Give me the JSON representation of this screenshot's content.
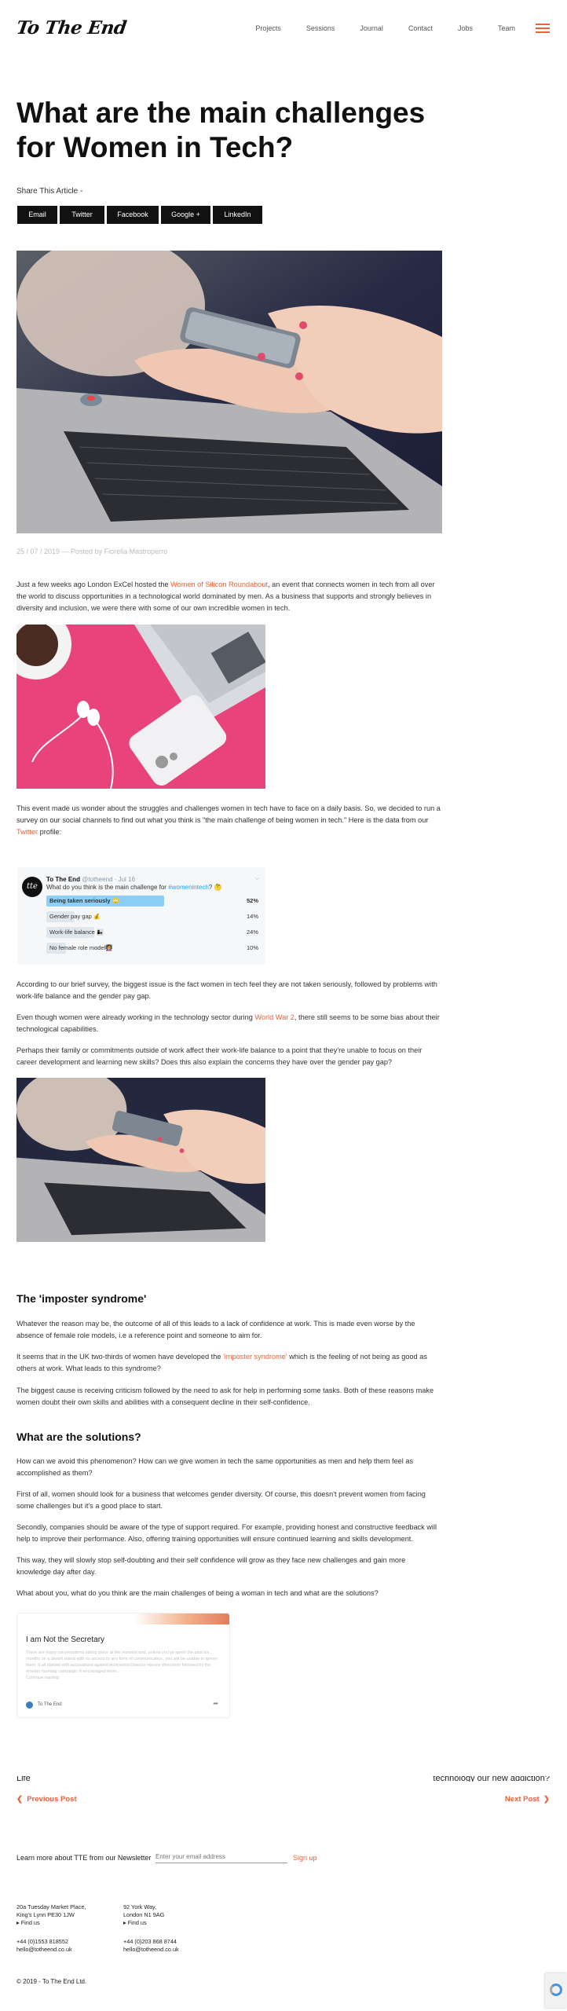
{
  "header": {
    "logo": "To The End",
    "nav": [
      "Projects",
      "Sessions",
      "Journal",
      "Contact",
      "Jobs",
      "Team"
    ]
  },
  "article": {
    "title": "What are the main challenges for Women in Tech?",
    "share_label": "Share This Article -",
    "share_buttons": [
      "Email",
      "Twitter",
      "Facebook",
      "Google +",
      "LinkedIn"
    ],
    "meta": "25 / 07 / 2019 — Posted by Fiorella Mastroperro",
    "p1_before": "Just a few weeks ago London ExCel hosted the ",
    "p1_link": "Women of Silicon Roundabout",
    "p1_after": ", an event that connects women in tech from all over the world to discuss opportunities in a technological world dominated by men. As a business that supports and strongly believes in diversity and inclusion, we were there with some of our own incredible women in tech.",
    "p2_before": "This event made us wonder about the struggles and challenges women in tech have to face on a daily basis. So, we decided to run a survey on our social channels to find out what you think is \"the main challenge of being women in tech.\" Here is the data from our ",
    "p2_link": "Twitter",
    "p2_after": " profile:",
    "p3": "According to our brief survey, the biggest issue is the fact women in tech feel they are not taken seriously, followed by problems with work-life balance and the gender pay gap.",
    "p4_before": "Even though women were already working in the technology sector during ",
    "p4_link": "World War 2",
    "p4_after": ", there still seems to be some bias about their technological capabilities.",
    "p5": "Perhaps their family or commitments outside of work affect their work-life balance to a point that they're unable to focus on their career development and learning new skills? Does this also explain the concerns they have over the gender pay gap?",
    "h_imposter": "The 'imposter syndrome'",
    "p6": "Whatever the reason may be, the outcome of all of this leads to a lack of confidence at work. This is made even worse by the absence of female role models, i.e a reference point and someone to aim for.",
    "p7_before": "It seems that in the UK two-thirds of women have developed the ",
    "p7_link": "'imposter syndrome'",
    "p7_after": " which is the feeling of not being as good as others at work. What leads to this syndrome?",
    "p8": "The biggest cause is receiving criticism followed by the need to ask for help in performing some tasks. Both of these reasons make women doubt their own skills and abilities with a consequent decline in their self-confidence.",
    "h_solutions": "What are the solutions?",
    "p9": "How can we avoid this phenomenon? How can we give women in tech the same opportunities as men and help them feel as accomplished as them?",
    "p10": "First of all, women should look for a business that welcomes gender diversity. Of course, this doesn't prevent women from facing some challenges but it's a good place to start.",
    "p11": "Secondly, companies should be aware of the type of support required. For example, providing honest and constructive feedback will help to improve their performance. Also, offering training opportunities will ensure continued learning and skills development.",
    "p12": "This way, they will slowly stop self-doubting and their self confidence will grow as they face new challenges and gain more knowledge day after day.",
    "p13": "What about you, what do you think are the main challenges of being a woman in tech and what are the solutions?"
  },
  "tweet": {
    "name": "To The End",
    "handle": "@totheend · Jul 16",
    "avatar_text": "tte",
    "question_before": "What do you think is the main challenge for ",
    "hashtag": "#womenintech",
    "question_after": "? 🤔",
    "options": [
      {
        "label": "Being taken seriously 🙄",
        "pct": "52%",
        "value": 52
      },
      {
        "label": "Gender pay gap 💰",
        "pct": "14%",
        "value": 14
      },
      {
        "label": "Work-life balance 👩‍👧",
        "pct": "24%",
        "value": 24
      },
      {
        "label": "No female role model👩‍🏫",
        "pct": "10%",
        "value": 10
      }
    ]
  },
  "embed_card": {
    "title": "I am Not the Secretary",
    "text": "There are many conversations taking place at the moment and, unless you've spent the past six months on a desert island with no access to any form of communication, you will be unable to ignore them. It all started with accusations against Hollywood Director Harvey Weinstein followed by the #metoo hashtag campaign. It encouraged more…",
    "link": "Continue reading",
    "footer": "To The End"
  },
  "post_nav": {
    "prev_clip": "Life",
    "next_clip": "technology our new addiction?",
    "prev": "Previous Post",
    "next": "Next Post"
  },
  "newsletter": {
    "label": "Learn more about TTE from our Newsletter",
    "placeholder": "Enter your email address",
    "button": "Sign up"
  },
  "footer": {
    "office1": [
      "20a Tuesday Market Place,",
      "King's Lynn PE30 1JW",
      "▸ Find us"
    ],
    "office2": [
      "92 York Way,",
      "London N1 9AG",
      "▸ Find us"
    ],
    "contact1": [
      "+44 (0)1553 818552",
      "hello@totheend.co.uk"
    ],
    "contact2": [
      "+44 (0)203 868 8744",
      "hello@totheend.co.uk"
    ],
    "copyright": "© 2019 - To The End Ltd."
  },
  "colors": {
    "accent": "#e8623a",
    "text": "#222222",
    "poll_win": "#8ed0f5"
  }
}
